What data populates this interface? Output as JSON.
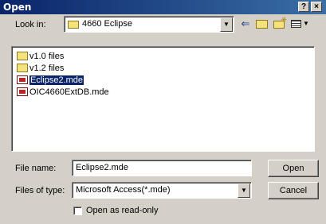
{
  "window": {
    "title": "Open",
    "help_label": "?",
    "close_label": "×"
  },
  "lookin": {
    "label": "Look in:",
    "value": "4660 Eclipse"
  },
  "toolbar": {
    "back_icon": "back-arrow-icon",
    "up_icon": "up-folder-icon",
    "newfolder_icon": "new-folder-icon",
    "view_icon": "view-menu-icon"
  },
  "files": [
    {
      "name": "v1.0 files",
      "type": "folder",
      "selected": false
    },
    {
      "name": "v1.2 files",
      "type": "folder",
      "selected": false
    },
    {
      "name": "Eclipse2.mde",
      "type": "mde",
      "selected": true
    },
    {
      "name": "OIC4660ExtDB.mde",
      "type": "mde",
      "selected": false
    }
  ],
  "filename": {
    "label": "File name:",
    "value": "Eclipse2.mde"
  },
  "filetype": {
    "label": "Files of type:",
    "value": "Microsoft Access(*.mde)"
  },
  "buttons": {
    "open": "Open",
    "cancel": "Cancel"
  },
  "readonly": {
    "label": "Open as read-only",
    "checked": false
  }
}
